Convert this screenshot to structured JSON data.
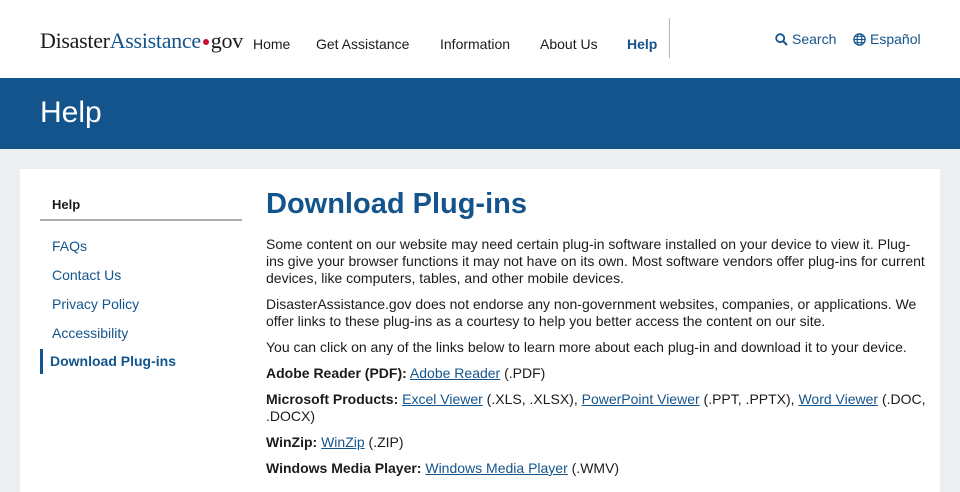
{
  "header": {
    "logo": {
      "part1": "Disaster",
      "part2": "Assistance",
      "part3": "gov"
    },
    "nav": [
      "Home",
      "Get Assistance",
      "Information",
      "About Us",
      "Help"
    ],
    "search_label": "Search",
    "language_label": "Español"
  },
  "banner": {
    "title": "Help"
  },
  "sidebar": {
    "heading": "Help",
    "items": [
      "FAQs",
      "Contact Us",
      "Privacy Policy",
      "Accessibility",
      "Download Plug-ins"
    ]
  },
  "content": {
    "title": "Download Plug-ins",
    "para1": "Some content on our website may need certain plug-in software installed on your device to view it. Plug-ins give your browser functions it may not have on its own. Most software vendors offer plug-ins for current devices, like computers, tables, and other mobile devices.",
    "para2": "DisasterAssistance.gov does not endorse any non-government websites, companies, or applications. We offer links to these plug-ins as a courtesy to help you better access the content on our site.",
    "para3": "You can click on any of the links below to learn more about each plug-in and download it to your device.",
    "plugins": [
      {
        "label": "Adobe Reader (PDF):",
        "links": [
          {
            "text": "Adobe Reader",
            "after": " (.PDF)"
          }
        ]
      },
      {
        "label": "Microsoft Products:",
        "links": [
          {
            "text": "Excel Viewer",
            "after": " (.XLS, .XLSX), "
          },
          {
            "text": "PowerPoint Viewer",
            "after": " (.PPT, .PPTX), "
          },
          {
            "text": "Word Viewer",
            "after": " (.DOC, .DOCX)"
          }
        ]
      },
      {
        "label": "WinZip:",
        "links": [
          {
            "text": "WinZip",
            "after": " (.ZIP)"
          }
        ]
      },
      {
        "label": "Windows Media Player:",
        "links": [
          {
            "text": "Windows Media Player",
            "after": " (.WMV)"
          }
        ]
      }
    ]
  },
  "colors": {
    "brand_blue": "#14548c",
    "logo_red_dot": "#c5112e",
    "page_gray": "#eceeef"
  }
}
